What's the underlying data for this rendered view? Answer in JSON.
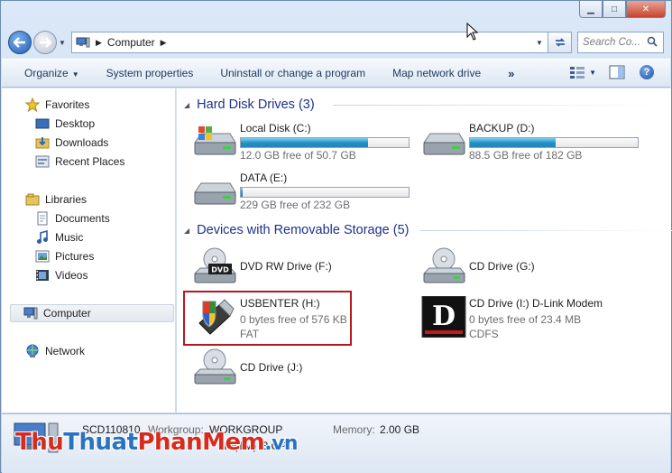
{
  "window": {
    "caption": {
      "minimize": "▁",
      "maximize": "□",
      "close": "✕"
    }
  },
  "address": {
    "location": "Computer",
    "search_placeholder": "Search Co..."
  },
  "toolbar": {
    "organize": "Organize",
    "system_properties": "System properties",
    "uninstall": "Uninstall or change a program",
    "map_drive": "Map network drive",
    "more": "»",
    "help": "?"
  },
  "nav": {
    "favorites": "Favorites",
    "desktop": "Desktop",
    "downloads": "Downloads",
    "recent": "Recent Places",
    "libraries": "Libraries",
    "documents": "Documents",
    "music": "Music",
    "pictures": "Pictures",
    "videos": "Videos",
    "computer": "Computer",
    "network": "Network"
  },
  "groups": {
    "hdd": "Hard Disk Drives (3)",
    "removable": "Devices with Removable Storage (5)"
  },
  "drives": {
    "c": {
      "name": "Local Disk (C:)",
      "free": "12.0 GB free of 50.7 GB",
      "used_fraction": 0.76
    },
    "d": {
      "name": "BACKUP (D:)",
      "free": "88.5 GB free of 182 GB",
      "used_fraction": 0.51
    },
    "e": {
      "name": "DATA (E:)",
      "free": "229 GB free of 232 GB",
      "used_fraction": 0.01
    },
    "f": {
      "name": "DVD RW Drive (F:)"
    },
    "g": {
      "name": "CD Drive (G:)"
    },
    "h": {
      "name": "USBENTER (H:)",
      "free": "0 bytes free of 576 KB",
      "fs": "FAT"
    },
    "i": {
      "name": "CD Drive (I:) D-Link Modem",
      "free": "0 bytes free of 23.4 MB",
      "fs": "CDFS"
    },
    "j": {
      "name": "CD Drive (J:)"
    }
  },
  "details": {
    "computer_name": "SCD110810",
    "workgroup_label": "Workgroup:",
    "workgroup": "WORKGROUP",
    "memory_label": "Memory:",
    "memory": "2.00 GB",
    "processor": "ore(TM) i3 CP..."
  },
  "watermark": {
    "part1": "Thu",
    "part2": "Thuat",
    "part3": "PhanMem",
    "part4": ".vn"
  },
  "colors": {
    "group_header": "#1e3287",
    "highlight_border": "#b6181f",
    "bar_fill": "#1e8fc4"
  }
}
